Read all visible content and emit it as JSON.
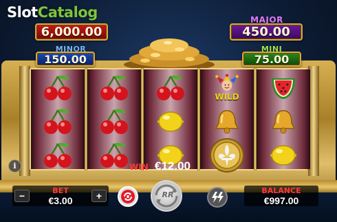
{
  "watermark": {
    "part1": "Slot",
    "part2": "Catalog"
  },
  "jackpots": {
    "grand": {
      "value": "6,000.00"
    },
    "major": {
      "title": "MAJOR",
      "value": "450.00"
    },
    "minor": {
      "title": "MINOR",
      "value": "150.00"
    },
    "mini": {
      "title": "MINI",
      "value": "75.00"
    }
  },
  "reels": [
    [
      "cherries",
      "cherries",
      "cherries"
    ],
    [
      "cherries",
      "cherries",
      "cherries"
    ],
    [
      "cherries",
      "lemon",
      "lemon"
    ],
    [
      "jester-wild",
      "bell",
      "fleur-de-lis-coin"
    ],
    [
      "watermelon",
      "bell",
      "lemon"
    ]
  ],
  "wild_label": "WILD",
  "win": {
    "label": "WIN",
    "amount": "€12.00"
  },
  "bet": {
    "title": "BET",
    "value": "€3.00",
    "minus": "−",
    "plus": "+"
  },
  "balance": {
    "title": "BALANCE",
    "value": "€997.00"
  },
  "info_label": "i",
  "spin_label": "RR",
  "colors": {
    "gold": "#e0bf6a",
    "grand_red": "#c81818",
    "major_purple": "#6a1a9a",
    "minor_blue": "#1a4ab8",
    "mini_green": "#2a8a1a",
    "win_red": "#ff3a3a"
  }
}
